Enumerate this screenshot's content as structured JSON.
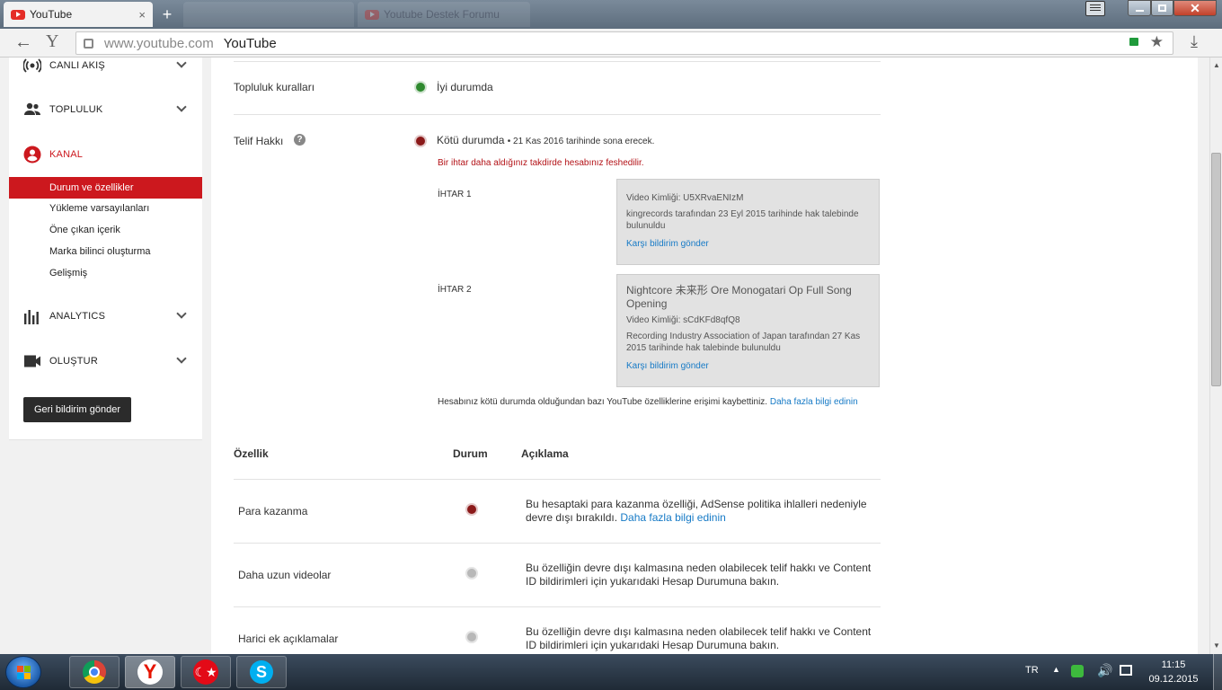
{
  "browser": {
    "tabs": [
      {
        "title": "YouTube"
      },
      {
        "title": ""
      },
      {
        "title": "Youtube Destek Forumu"
      }
    ],
    "url_domain": "www.youtube.com",
    "url_title": "YouTube"
  },
  "sidebar": {
    "sections": [
      {
        "label": "CANLI AKIŞ",
        "icon": "live-icon"
      },
      {
        "label": "TOPLULUK",
        "icon": "community-icon"
      },
      {
        "label": "KANAL",
        "icon": "channel-icon"
      }
    ],
    "channel_items": [
      {
        "label": "Durum ve özellikler"
      },
      {
        "label": "Yükleme varsayılanları"
      },
      {
        "label": "Öne çıkan içerik"
      },
      {
        "label": "Marka bilinci oluşturma"
      },
      {
        "label": "Gelişmiş"
      }
    ],
    "analytics": {
      "label": "ANALYTICS",
      "icon": "analytics-icon"
    },
    "create": {
      "label": "OLUŞTUR",
      "icon": "video-camera-icon"
    },
    "feedback_button": "Geri bildirim gönder"
  },
  "status": {
    "community": {
      "label": "Topluluk kuralları",
      "value": "İyi durumda",
      "color": "#2f8a2f"
    },
    "copyright": {
      "label": "Telif Hakkı",
      "value": "Kötü durumda",
      "expiry": "• 21 Kas 2016 tarihinde sona erecek.",
      "warning": "Bir ihtar daha aldığınız takdirde hesabınız feshedilir.",
      "color": "#8b1a1a"
    },
    "strikes": [
      {
        "label": "İHTAR 1",
        "video_title": "",
        "video_id": "Video Kimliği: U5XRvaENIzM",
        "claim": "kingrecords tarafından 23 Eyl 2015 tarihinde hak talebinde bulunuldu",
        "action": "Karşı bildirim gönder"
      },
      {
        "label": "İHTAR 2",
        "video_title": "Nightcore 未来形 Ore Monogatari Op Full Song Opening",
        "video_id": "Video Kimliği: sCdKFd8qfQ8",
        "claim": "Recording Industry Association of Japan tarafından 27 Kas 2015 tarihinde hak talebinde bulunuldu",
        "action": "Karşı bildirim gönder"
      }
    ],
    "notice": "Hesabınız kötü durumda olduğundan bazı YouTube özelliklerine erişimi kaybettiniz.",
    "notice_link": "Daha fazla bilgi edinin"
  },
  "features": {
    "headers": {
      "feature": "Özellik",
      "status": "Durum",
      "description": "Açıklama"
    },
    "rows": [
      {
        "name": "Para kazanma",
        "status": "disabled",
        "description": "Bu hesaptaki para kazanma özelliği, AdSense politika ihlalleri nedeniyle devre dışı bırakıldı.",
        "link": "Daha fazla bilgi edinin"
      },
      {
        "name": "Daha uzun videolar",
        "status": "unavailable",
        "description": "Bu özelliğin devre dışı kalmasına neden olabilecek telif hakkı ve Content ID bildirimleri için yukarıdaki Hesap Durumuna bakın.",
        "link": ""
      },
      {
        "name": "Harici ek açıklamalar",
        "status": "unavailable",
        "description": "Bu özelliğin devre dışı kalmasına neden olabilecek telif hakkı ve Content ID bildirimleri için yukarıdaki Hesap Durumuna bakın.",
        "link": ""
      }
    ]
  },
  "taskbar": {
    "language": "TR",
    "time": "11:15",
    "date": "09.12.2015",
    "apps": [
      "start-orb-icon",
      "chrome-icon",
      "yandex-browser-icon",
      "turkey-flag-icon",
      "skype-icon"
    ]
  }
}
